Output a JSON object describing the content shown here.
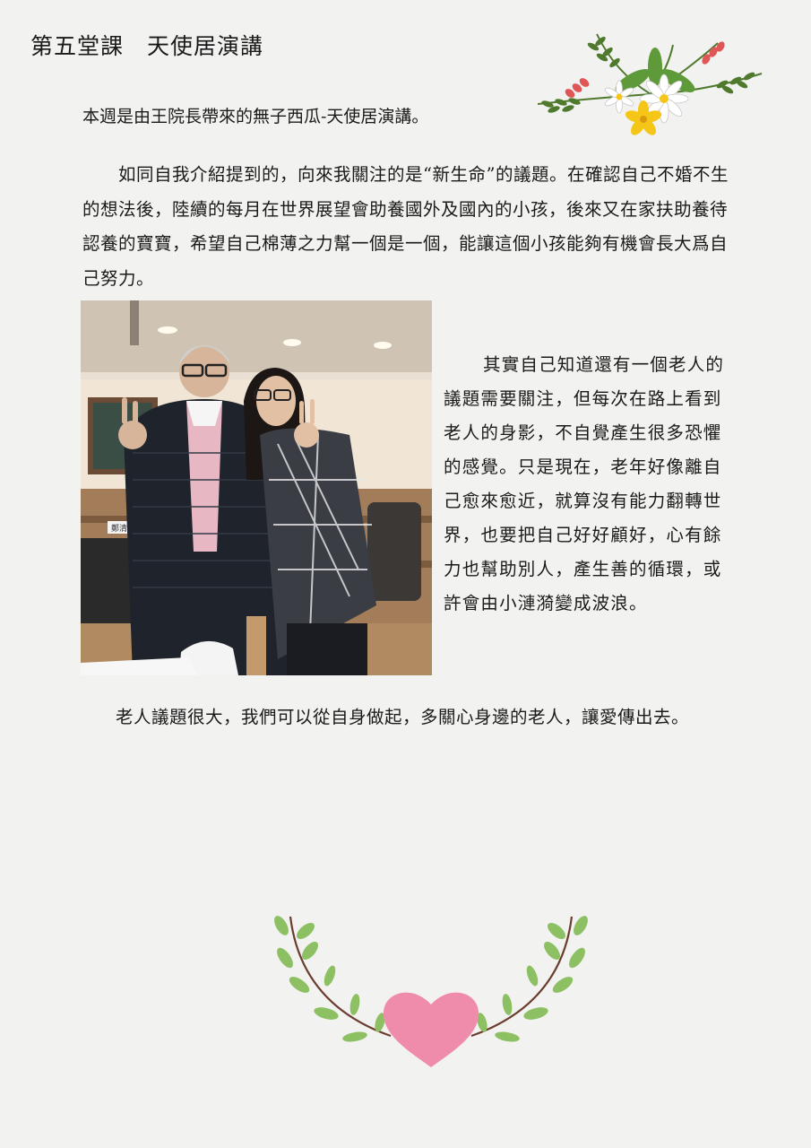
{
  "page": {
    "title": "第五堂課　天使居演講",
    "intro": "本週是由王院長帶來的無子西瓜-天使居演講。",
    "paragraph_new_life": "如同自我介紹提到的，向來我關注的是“新生命”的議題。在確認自己不婚不生的想法後，陸續的每月在世界展望會助養國外及國內的小孩，後來又在家扶助養待認養的寶寶，希望自己棉薄之力幫一個是一個，能讓這個小孩能夠有機會長大爲自己努力。",
    "paragraph_elderly": "其實自己知道還有一個老人的議題需要關注，但每次在路上看到老人的身影，不自覺產生很多恐懼的感覺。只是現在，老年好像離自己愈來愈近，就算沒有能力翻轉世界，也要把自己好好顧好，心有餘力也幫助別人，產生善的循環，或許會由小漣漪變成波浪。",
    "closing": "老人議題很大，我們可以從自身做起，多關心身邊的老人，讓愛傳出去。"
  },
  "photo": {
    "sign_text": "鄭清"
  },
  "colors": {
    "background": "#f2f2f0",
    "heart": "#f08cab",
    "leaf": "#8cc063",
    "stem": "#6b3d2e",
    "flower_white": "#ffffff",
    "flower_yellow": "#f5c518",
    "flower_red": "#e05555"
  },
  "icons": {
    "top_decoration": "flower-bouquet-icon",
    "bottom_decoration": "heart-laurel-icon"
  }
}
